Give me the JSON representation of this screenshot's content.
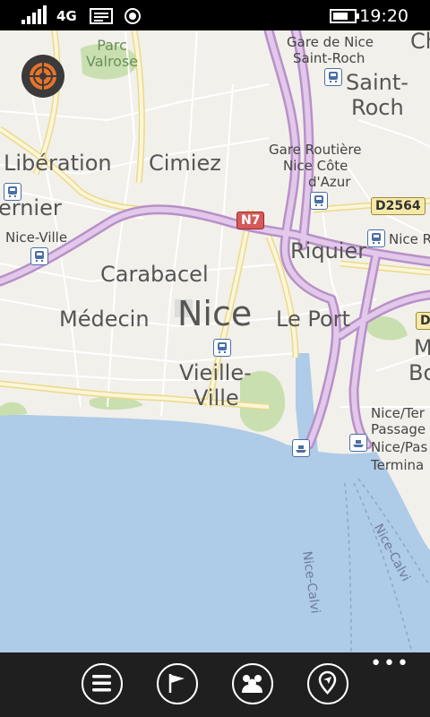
{
  "status_bar": {
    "network": "4G",
    "time": "19:20",
    "icons": [
      "signal-bars-icon",
      "message-icon",
      "sync-icon",
      "battery-icon"
    ]
  },
  "map": {
    "city_label": "Nice",
    "district_labels": {
      "liberation": "Libération",
      "cimiez": "Cimiez",
      "saint_roch_1": "Saint-",
      "saint_roch_2": "Roch",
      "riquier": "Riquier",
      "carabacel": "Carabacel",
      "medecin": "Médecin",
      "le_port": "Le Port",
      "vieille_1": "Vieille-",
      "vieille_2": "Ville",
      "ernier": "ernier",
      "ch": "Ch",
      "m": "M",
      "bo": "Bo"
    },
    "park_label_1": "Parc",
    "park_label_2": "Valrose",
    "poi_labels": {
      "gare_de_nice_1": "Gare de Nice",
      "gare_de_nice_2": "Saint-Roch",
      "gare_routiere_1": "Gare Routière",
      "gare_routiere_2": "Nice Côte",
      "gare_routiere_3": "d'Azur",
      "nice_ville": "Nice-Ville",
      "nice_ri": "Nice Ri",
      "nice_ter_1": "Nice/Ter",
      "nice_ter_2": "Passage",
      "nice_ter_3": "Nice/Pas",
      "nice_ter_4": "Termina"
    },
    "road_shields": {
      "n7": "N7",
      "d2564": "D2564",
      "d6": "D"
    },
    "ferry_labels": {
      "nice_calvi_1": "Nice-Calvi",
      "nice_calvi_2": "Nice-Calvi"
    },
    "colors": {
      "land": "#f2f0ea",
      "water": "#aecbe8",
      "park": "#c9dfb0",
      "highway": "#d8b8df",
      "road": "#fbf6d8"
    }
  },
  "app_bar": {
    "buttons": [
      {
        "name": "menu-button",
        "icon": "hamburger-icon"
      },
      {
        "name": "route-button",
        "icon": "flag-icon"
      },
      {
        "name": "people-button",
        "icon": "people-icon"
      },
      {
        "name": "places-button",
        "icon": "map-pin-icon"
      }
    ],
    "more_label": "•••"
  }
}
